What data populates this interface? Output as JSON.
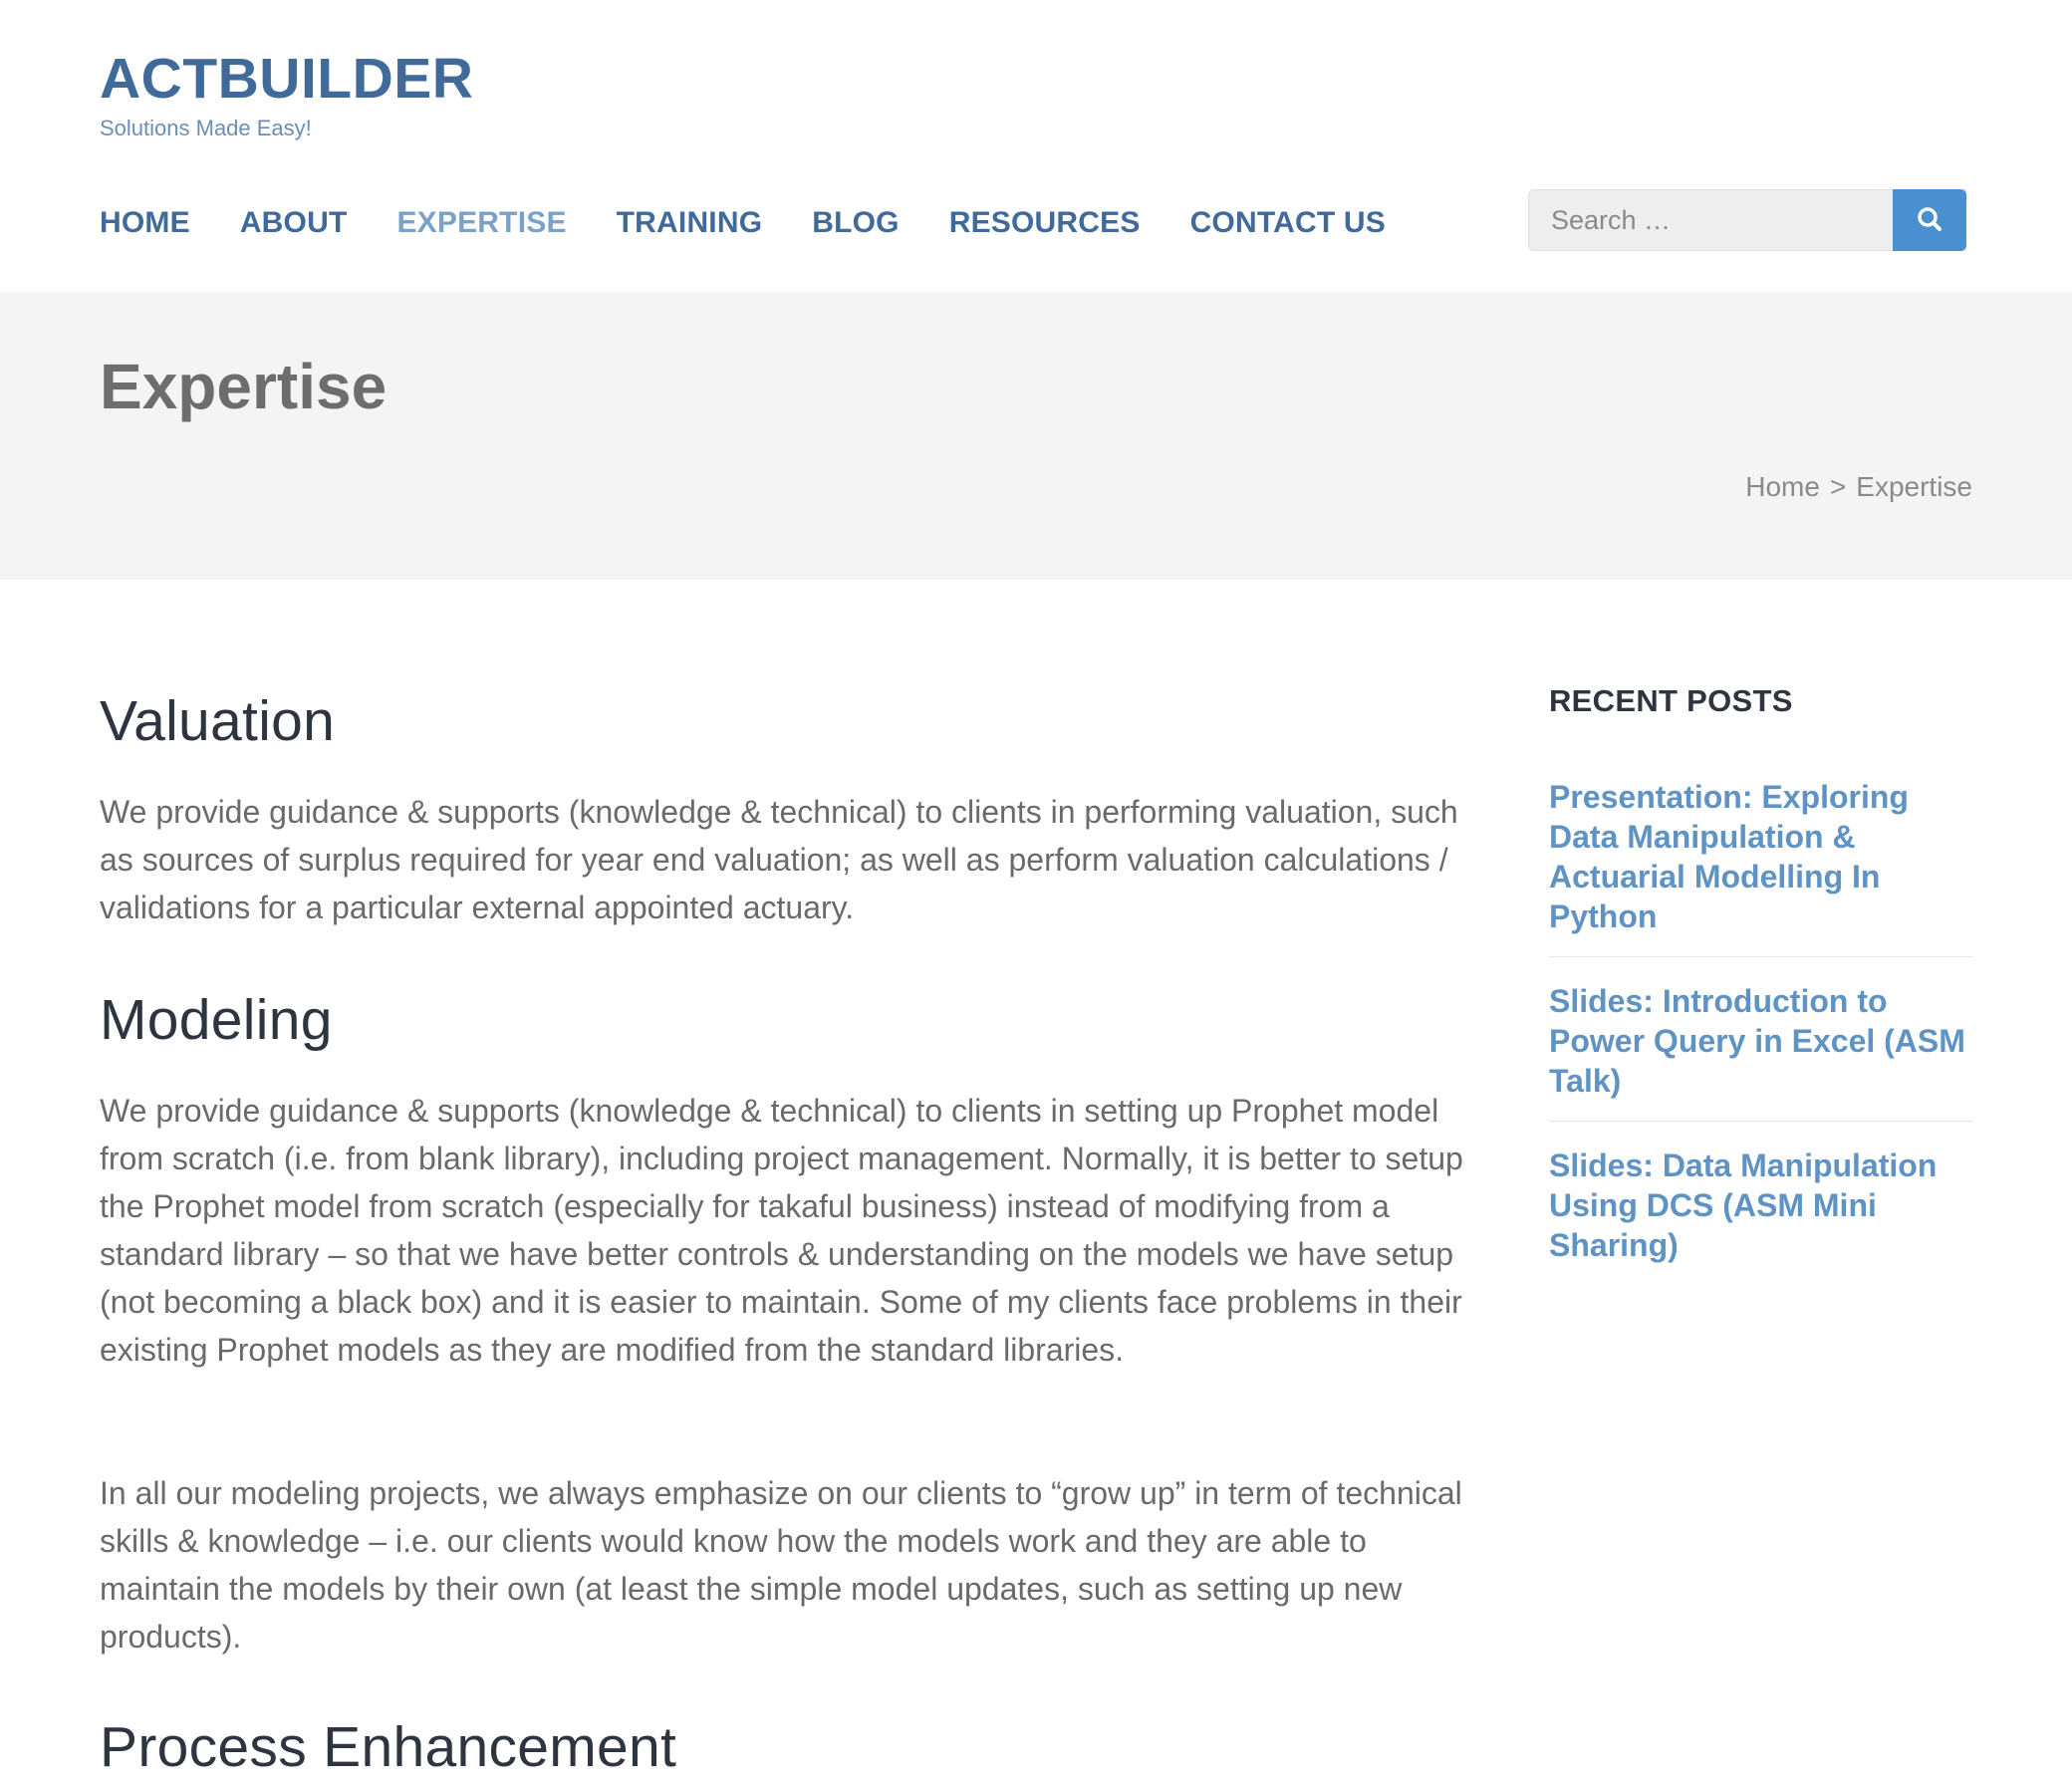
{
  "site": {
    "title": "ACTBUILDER",
    "tagline": "Solutions Made Easy!"
  },
  "nav": {
    "items": [
      {
        "label": "HOME"
      },
      {
        "label": "ABOUT"
      },
      {
        "label": "EXPERTISE",
        "active": true
      },
      {
        "label": "TRAINING"
      },
      {
        "label": "BLOG"
      },
      {
        "label": "RESOURCES"
      },
      {
        "label": "CONTACT US"
      }
    ]
  },
  "search": {
    "placeholder": "Search …",
    "button_icon": "search-icon"
  },
  "page": {
    "title": "Expertise",
    "breadcrumb": {
      "home": "Home",
      "separator": ">",
      "current": "Expertise"
    }
  },
  "content": {
    "sections": [
      {
        "heading": "Valuation",
        "paragraphs": [
          "We provide guidance & supports (knowledge & technical) to clients in performing valuation, such as sources of surplus required for year end valuation; as well as perform valuation calculations / validations for a particular external appointed actuary."
        ]
      },
      {
        "heading": "Modeling",
        "paragraphs": [
          "We provide guidance & supports (knowledge & technical) to clients in setting up Prophet model from scratch (i.e. from blank library), including project management. Normally, it is better to setup the Prophet model from scratch (especially for takaful business) instead of modifying from a standard library – so that we have better controls & understanding on the models we have setup (not becoming a black box) and it is easier to maintain. Some of my clients face problems in their existing Prophet models as they are modified from the standard libraries.",
          "In all our modeling projects, we always emphasize on our clients to “grow up” in term of technical skills & knowledge – i.e. our clients would know how the models work and they are able to maintain the models by their own (at least the simple model updates, such as setting up new products)."
        ]
      },
      {
        "heading": "Process Enhancement",
        "paragraphs": []
      }
    ]
  },
  "sidebar": {
    "title": "RECENT POSTS",
    "posts": [
      {
        "title": "Presentation: Exploring Data Manipulation & Actuarial Modelling In Python"
      },
      {
        "title": "Slides: Introduction to Power Query in Excel (ASM Talk)"
      },
      {
        "title": "Slides: Data Manipulation Using DCS (ASM Mini Sharing)"
      }
    ]
  },
  "colors": {
    "brand": "#3f6a99",
    "nav_active": "#7aa2c8",
    "search_button": "#4a8fd0",
    "link": "#5f93c4",
    "title_band": "#f4f4f4"
  }
}
